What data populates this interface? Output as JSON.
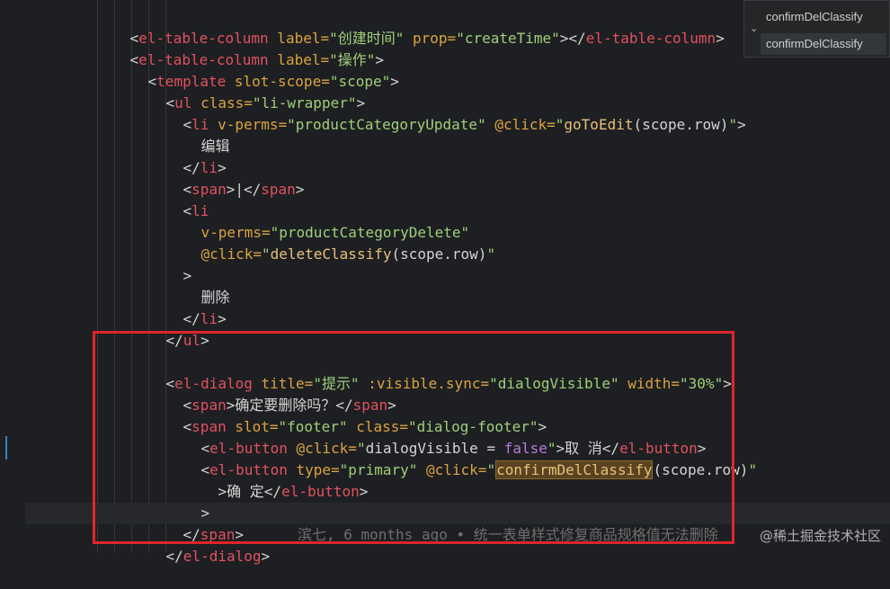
{
  "suggest": {
    "item1": "confirmDelClassify",
    "item2": "confirmDelClassify"
  },
  "code": {
    "l1": {
      "open": "<",
      "tag": "el-table-column",
      "attr": " label=",
      "val": "\"创建时间\"",
      "attr2": " prop=",
      "val2": "\"createTime\"",
      "close": "></",
      "tag2": "el-table-column",
      "end": ">"
    },
    "l2": {
      "open": "<",
      "tag": "el-table-column",
      "attr": " label=",
      "val": "\"操作\"",
      "end": ">"
    },
    "l3": {
      "open": "<",
      "tag": "template",
      "attr": " slot-scope=",
      "val": "\"scope\"",
      "end": ">"
    },
    "l4": {
      "open": "<",
      "tag": "ul",
      "attr": " class=",
      "val": "\"li-wrapper\"",
      "end": ">"
    },
    "l5": {
      "open": "<",
      "tag": "li",
      "attr": " v-perms=",
      "val": "\"productCategoryUpdate\"",
      "at": " @",
      "attr2": "click=",
      "q1": "\"",
      "fn": "goToEdit",
      "args": "(scope.row)",
      "q2": "\"",
      "end": ">"
    },
    "l6": "编辑",
    "l7": {
      "open": "</",
      "tag": "li",
      "end": ">"
    },
    "l8": {
      "open": "<",
      "tag": "span",
      "mid": ">|</",
      "tag2": "span",
      "end": ">"
    },
    "l9": {
      "open": "<",
      "tag": "li"
    },
    "l10": {
      "attr": "v-perms=",
      "val": "\"productCategoryDelete\""
    },
    "l11": {
      "at": "@",
      "attr": "click=",
      "q1": "\"",
      "fn": "deleteClassify",
      "args": "(scope.row)",
      "q2": "\""
    },
    "l12": ">",
    "l13": "删除",
    "l14": {
      "open": "</",
      "tag": "li",
      "end": ">"
    },
    "l15": {
      "open": "</",
      "tag": "ul",
      "end": ">"
    },
    "l17": {
      "open": "<",
      "tag": "el-dialog",
      "attr": " title=",
      "val": "\"提示\"",
      "attr2": " :visible.sync=",
      "val2": "\"dialogVisible\"",
      "attr3": " width=",
      "val3": "\"30%\"",
      "end": ">"
    },
    "l18": {
      "open": "<",
      "tag": "span",
      "text": ">确定要删除吗？</",
      "tag2": "span",
      "end": ">"
    },
    "l19": {
      "open": "<",
      "tag": "span",
      "attr": " slot=",
      "val": "\"footer\"",
      "attr2": " class=",
      "val2": "\"dialog-footer\"",
      "end": ">"
    },
    "l20": {
      "open": "<",
      "tag": "el-button",
      "at": " @",
      "attr": "click=",
      "q1": "\"",
      "expr": "dialogVisible",
      "eq": " = ",
      "kw": "false",
      "q2": "\"",
      "text": ">取 消</",
      "tag2": "el-button",
      "end": ">"
    },
    "l21": {
      "open": "<",
      "tag": "el-button",
      "attr": " type=",
      "val": "\"primary\"",
      "at": " @",
      "attr2": "click=",
      "q1": "\"",
      "fn": "confirmDelClassify",
      "args": "(scope.row)",
      "q2": "\""
    },
    "l22": {
      "text": ">确 定</",
      "tag": "el-button",
      "end": ">"
    },
    "l23": ">",
    "l24": {
      "open": "</",
      "tag": "span",
      "end": ">",
      "blame": "滨七, 6 months ago • 统一表单样式修复商品规格值无法删除"
    },
    "l25": {
      "open": "</",
      "tag": "el-dialog",
      "end": ">"
    }
  },
  "watermark": "@稀土掘金技术社区"
}
